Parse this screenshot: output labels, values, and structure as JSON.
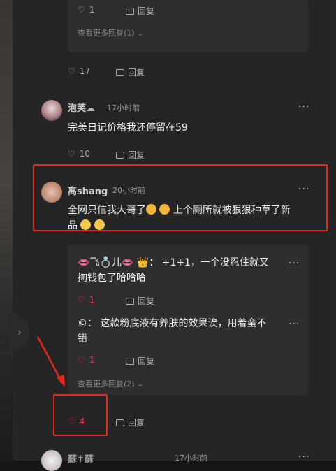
{
  "reply_box_top": {
    "like_count": "1",
    "reply_label": "回复",
    "more_replies": "查看更多回复(1)"
  },
  "comment_top": {
    "like_count": "17",
    "reply_label": "回复"
  },
  "comment1": {
    "username": "泡芙",
    "time": "17小时前",
    "text": "完美日记价格我还停留在59",
    "like_count": "10",
    "reply_label": "回复",
    "more": "···"
  },
  "comment2": {
    "username": "离shang",
    "time": "20小时前",
    "text_line1": "全网只信我大哥了",
    "text_mid": "上个厕所就被狠狠种草了新",
    "text_line2": "品",
    "like_count": "4",
    "reply_label": "回复",
    "more": "···",
    "replies": [
      {
        "author": "飞",
        "author2": "儿",
        "sep": "：",
        "text_line1": "+1+1，一个没忍住就又",
        "text_line2": "掏钱包了哈哈哈",
        "like_count": "1",
        "reply_label": "回复"
      },
      {
        "author": "©",
        "sep": "：",
        "text_line1": "这款粉底液有养肤的效果诶，用着蛮不",
        "text_line2": "错",
        "like_count": "1",
        "reply_label": "回复"
      }
    ],
    "more_replies": "查看更多回复(2)"
  },
  "comment3": {
    "username": "蘇✝蘇",
    "time": "17小时前",
    "more": "···"
  },
  "collapse_icon": "chevron-right-icon",
  "colors": {
    "accent_red": "#fe2c55",
    "highlight_border": "#e8261a",
    "arrow": "#e8261a"
  }
}
